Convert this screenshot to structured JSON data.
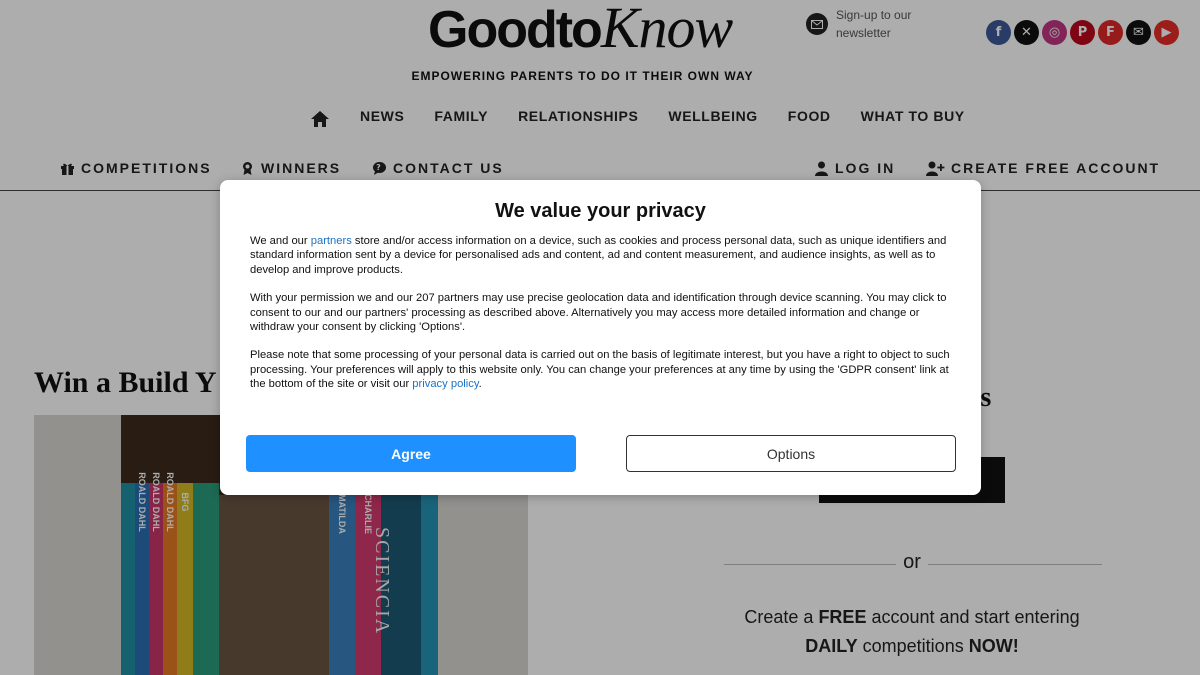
{
  "header": {
    "logo_part1": "Goodto",
    "logo_part2": "Know",
    "newsletter_line1": "Sign-up to our",
    "newsletter_line2": "newsletter",
    "tagline": "EMPOWERING PARENTS TO DO IT THEIR OWN WAY",
    "socials": [
      {
        "name": "facebook",
        "glyph": "f",
        "color": "#3b5998"
      },
      {
        "name": "x",
        "glyph": "✕",
        "color": "#111111"
      },
      {
        "name": "instagram",
        "glyph": "◎",
        "color": "#c13584"
      },
      {
        "name": "pinterest",
        "glyph": "P",
        "color": "#bd081c"
      },
      {
        "name": "flipboard",
        "glyph": "F",
        "color": "#e12828"
      },
      {
        "name": "email",
        "glyph": "✉",
        "color": "#111111"
      },
      {
        "name": "youtube",
        "glyph": "▶",
        "color": "#e52d27"
      }
    ]
  },
  "main_nav": {
    "items": [
      "NEWS",
      "FAMILY",
      "RELATIONSHIPS",
      "WELLBEING",
      "FOOD",
      "WHAT TO BUY"
    ]
  },
  "sub_nav": {
    "competitions": "COMPETITIONS",
    "winners": "WINNERS",
    "contact": "CONTACT US",
    "login": "LOG IN",
    "create_account": "CREATE FREE ACCOUNT"
  },
  "article": {
    "title": "Win a Build Y",
    "hero_book_text": "SCIENCIA",
    "book_labels": [
      "ROALD DAHL",
      "ROALD DAHL",
      "ROALD DAHL",
      "BFG",
      "MATILDA",
      "CHARLIE"
    ]
  },
  "sidebar": {
    "heading": "bers",
    "or": "or",
    "create_prefix": "Create a ",
    "create_free": "FREE",
    "create_middle": " account and start entering",
    "create_daily": "DAILY",
    "create_comps": " competitions ",
    "create_now": "NOW!"
  },
  "consent": {
    "title": "We value your privacy",
    "p1_before": "We and our ",
    "p1_link": "partners",
    "p1_after": " store and/or access information on a device, such as cookies and process personal data, such as unique identifiers and standard information sent by a device for personalised ads and content, ad and content measurement, and audience insights, as well as to develop and improve products.",
    "p2": "With your permission we and our 207 partners may use precise geolocation data and identification through device scanning. You may click to consent to our and our partners' processing as described above. Alternatively you may access more detailed information and change or withdraw your consent by clicking 'Options'.",
    "p3_before": "Please note that some processing of your personal data is carried out on the basis of legitimate interest, but you have a right to object to such processing. Your preferences will apply to this website only. You can change your preferences at any time by using the 'GDPR consent' link at the bottom of the site or visit our ",
    "p3_link": "privacy policy",
    "p3_after": ".",
    "agree_label": "Agree",
    "options_label": "Options"
  },
  "colors": {
    "accent": "#1e90ff",
    "link": "#1a73c7"
  }
}
